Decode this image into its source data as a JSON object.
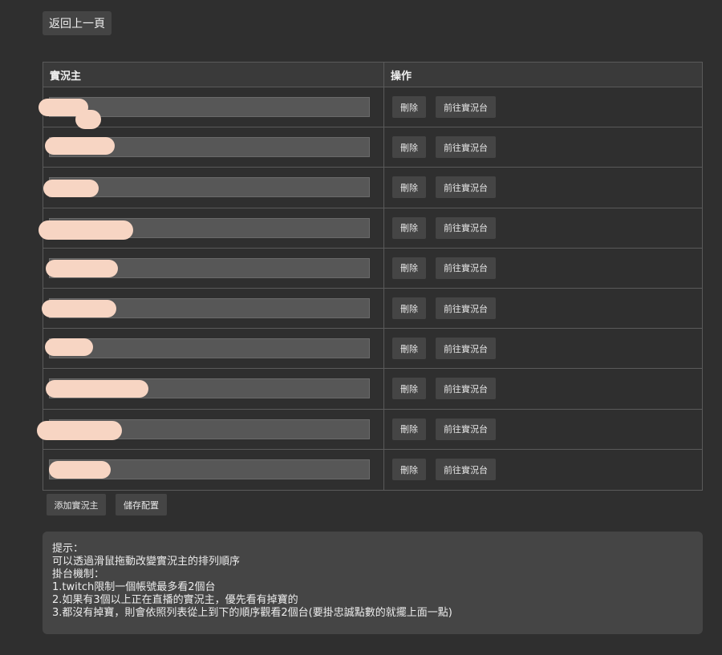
{
  "header": {
    "back_label": "返回上一頁"
  },
  "table": {
    "columns": [
      "實況主",
      "操作"
    ],
    "rows": [
      {
        "name": "",
        "delete_label": "刪除",
        "goto_label": "前往實況台"
      },
      {
        "name": "",
        "delete_label": "刪除",
        "goto_label": "前往實況台"
      },
      {
        "name": "",
        "delete_label": "刪除",
        "goto_label": "前往實況台"
      },
      {
        "name": "",
        "delete_label": "刪除",
        "goto_label": "前往實況台"
      },
      {
        "name": "",
        "delete_label": "刪除",
        "goto_label": "前往實況台"
      },
      {
        "name": "",
        "delete_label": "刪除",
        "goto_label": "前往實況台"
      },
      {
        "name": "",
        "delete_label": "刪除",
        "goto_label": "前往實況台"
      },
      {
        "name": "",
        "delete_label": "刪除",
        "goto_label": "前往實況台"
      },
      {
        "name": "",
        "delete_label": "刪除",
        "goto_label": "前往實況台"
      },
      {
        "name": "",
        "delete_label": "刪除",
        "goto_label": "前往實況台"
      }
    ]
  },
  "actions": {
    "add_label": "添加實況主",
    "save_label": "儲存配置"
  },
  "hint": {
    "lines": [
      "提示：",
      "可以透過滑鼠拖動改變實況主的排列順序",
      "掛台機制：",
      "1.twitch限制一個帳號最多看2個台",
      "2.如果有3個以上正在直播的實況主，優先看有掉寶的",
      "3.都沒有掉寶，則會依照列表從上到下的順序觀看2個台(要掛忠誠點數的就擺上面一點)"
    ]
  },
  "colors": {
    "background": "#2f2f2f",
    "button": "#454545",
    "redaction": "#f7d5c3"
  }
}
